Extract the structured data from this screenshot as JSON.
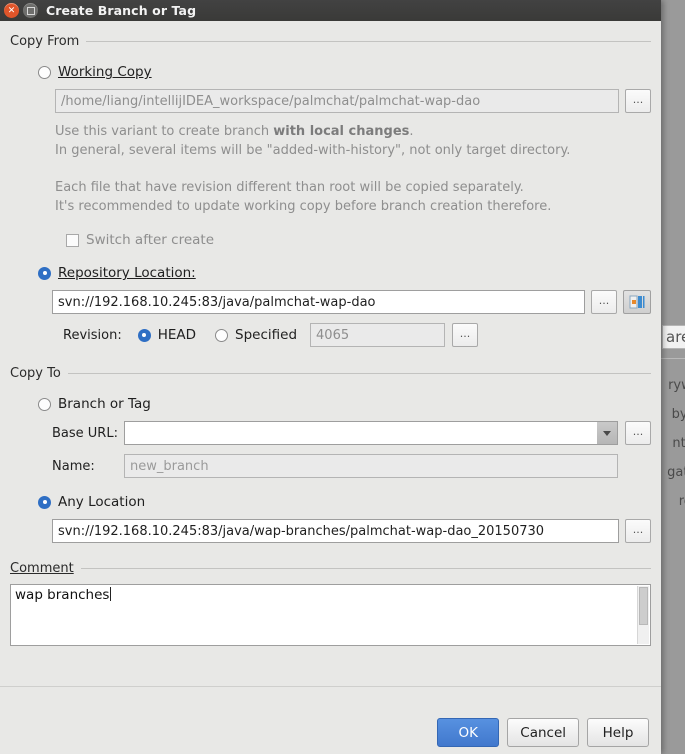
{
  "window": {
    "title": "Create Branch or Tag",
    "close_icon": "close-icon",
    "maximize_icon": "maximize-icon"
  },
  "copy_from": {
    "section_label": "Copy From",
    "working_copy": {
      "label": "Working Copy",
      "selected": false,
      "path": "/home/liang/intellijIDEA_workspace/palmchat/palmchat-wap-dao",
      "browse_label": "...",
      "hint_line1_pre": "Use this variant to create branch ",
      "hint_line1_bold": "with local changes",
      "hint_line1_post": ".",
      "hint_line2": "In general, several items will be \"added-with-history\", not only target directory.",
      "hint_line3": "Each file that have revision different than root will be copied separately.",
      "hint_line4": "It's recommended to update working copy before branch creation therefore.",
      "switch_after_create_label": "Switch after create",
      "switch_after_create_checked": false
    },
    "repository_location": {
      "label": "Repository Location:",
      "selected": true,
      "url": "svn://192.168.10.245:83/java/palmchat-wap-dao",
      "browse_label": "...",
      "history_icon": "repository-browser-icon",
      "revision_label": "Revision:",
      "head_label": "HEAD",
      "head_selected": true,
      "specified_label": "Specified",
      "specified_selected": false,
      "specified_value": "4065",
      "specified_browse_label": "..."
    }
  },
  "copy_to": {
    "section_label": "Copy To",
    "branch_or_tag": {
      "label": "Branch or Tag",
      "selected": false,
      "base_url_label": "Base URL:",
      "base_url_value": "",
      "base_url_dropdown_icon": "chevron-down-icon",
      "base_url_browse_label": "...",
      "name_label": "Name:",
      "name_placeholder": "new_branch",
      "name_value": ""
    },
    "any_location": {
      "label": "Any Location",
      "selected": true,
      "url": "svn://192.168.10.245:83/java/wap-branches/palmchat-wap-dao_20150730",
      "browse_label": "..."
    }
  },
  "comment": {
    "section_label": "Comment",
    "value": "wap branches"
  },
  "footer": {
    "ok_label": "OK",
    "cancel_label": "Cancel",
    "help_label": "Help"
  },
  "background_window": {
    "field_text": "are",
    "lines": [
      "rywh",
      "by n",
      "nt Fi",
      "gatio",
      "rop "
    ]
  },
  "colors": {
    "accent": "#2f6fc4",
    "default_button": "#4178cd",
    "dialog_background": "#e8e8e6",
    "titlebar": "#3a3a38",
    "close_button": "#e0552a"
  }
}
